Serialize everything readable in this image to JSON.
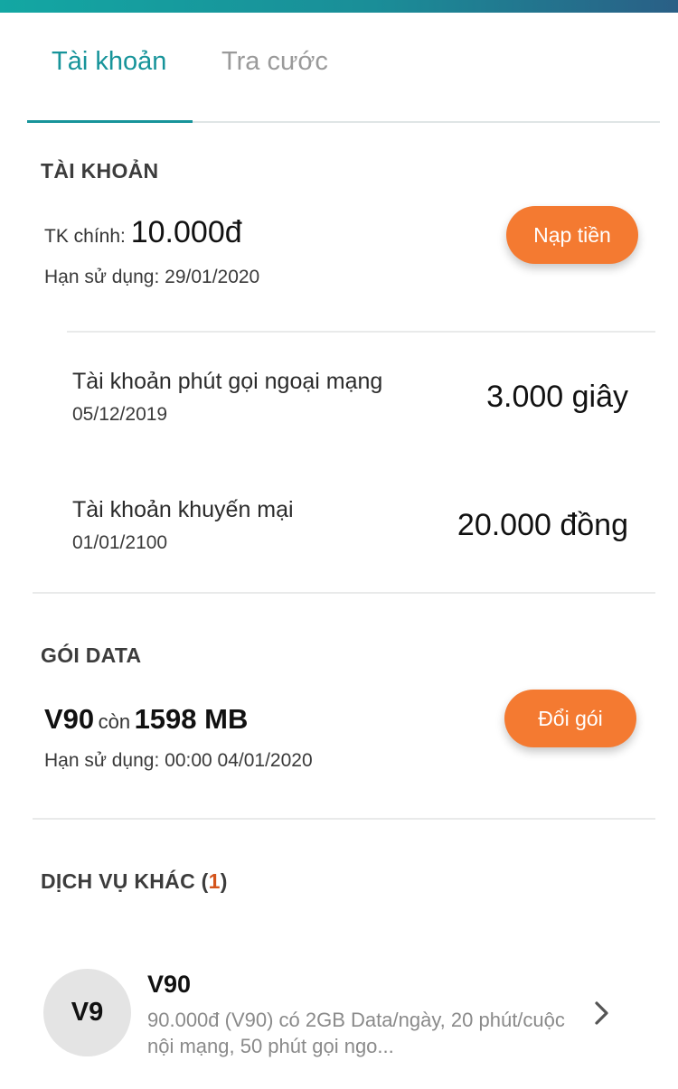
{
  "tabs": [
    {
      "label": "Tài khoản",
      "active": true
    },
    {
      "label": "Tra cước",
      "active": false
    }
  ],
  "account": {
    "section_title": "TÀI KHOẢN",
    "main_label": "TK chính:",
    "main_balance": "10.000đ",
    "expiry": "Hạn sử dụng: 29/01/2020",
    "topup_button": "Nạp tiền",
    "sub_accounts": [
      {
        "title": "Tài khoản phút gọi ngoại mạng",
        "date": "05/12/2019",
        "value": "3.000 giây"
      },
      {
        "title": "Tài khoản khuyến mại",
        "date": "01/01/2100",
        "value": "20.000 đồng"
      }
    ]
  },
  "data_package": {
    "section_title": "GÓI DATA",
    "package_name": "V90",
    "remaining_label": "còn",
    "remaining_value": "1598 MB",
    "expiry": "Hạn sử dụng: 00:00 04/01/2020",
    "change_button": "Đổi gói"
  },
  "other_services": {
    "section_title": "DỊCH VỤ KHÁC (",
    "count": "1",
    "section_title_close": ")",
    "items": [
      {
        "avatar_text": "V9",
        "name": "V90",
        "description": "90.000đ (V90) có 2GB Data/ngày, 20 phút/cuộc nội mạng, 50 phút gọi ngo...",
        "icon": "chevron-right-icon"
      }
    ]
  },
  "colors": {
    "accent": "#17949a",
    "button": "#f47a31",
    "count": "#d4541c"
  }
}
